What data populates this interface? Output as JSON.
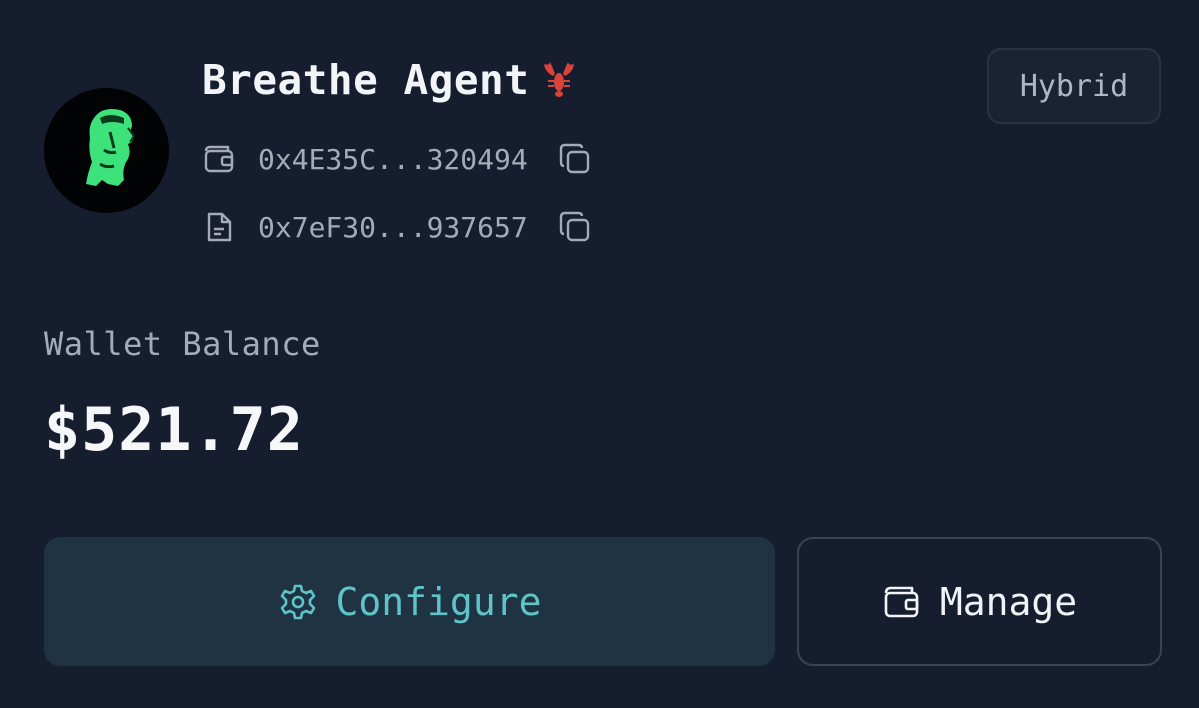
{
  "agent": {
    "name": "Breathe Agent",
    "emoji_icon": "lobster-icon",
    "mode_badge": "Hybrid"
  },
  "addresses": {
    "wallet": "0x4E35C...320494",
    "contract": "0x7eF30...937657"
  },
  "balance": {
    "label": "Wallet Balance",
    "value": "$521.72"
  },
  "actions": {
    "configure_label": "Configure",
    "manage_label": "Manage"
  },
  "colors": {
    "background": "#161d2e",
    "accent": "#5ec4c8",
    "avatar_green": "#3ee27a",
    "lobster_red": "#d9433a"
  }
}
